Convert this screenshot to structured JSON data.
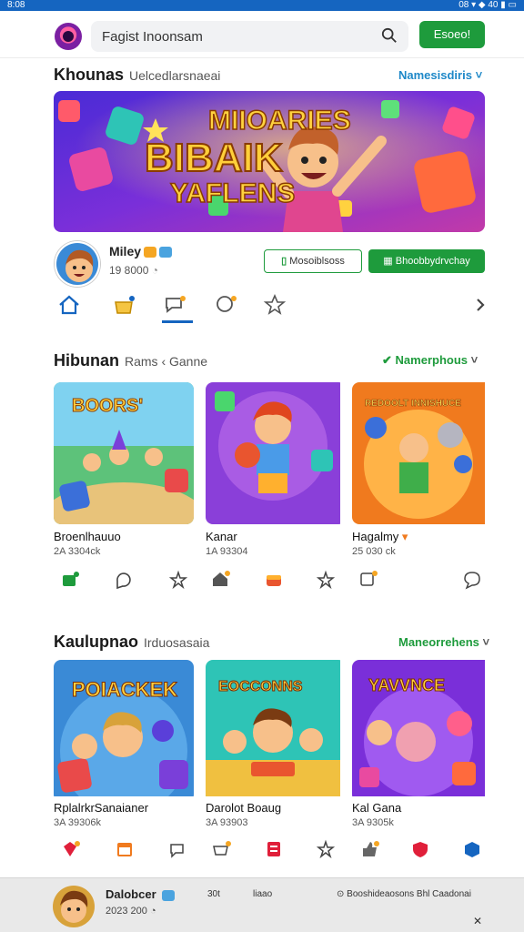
{
  "status": {
    "left": "8:08",
    "right": "08 ▾ ◆ 40 ▮ ▭"
  },
  "search": {
    "text": "Fagist Inoonsam"
  },
  "topbar": {
    "button_label": "Esoeo!"
  },
  "featured": {
    "title": "Khounas",
    "subtitle": "Uelcedlarsnaeai",
    "link": "Namesisdiris",
    "banner_line1": "MIIOARIES",
    "banner_line2": "BIBAIK",
    "banner_line3": "YAFLENS"
  },
  "profile": {
    "name": "Miley",
    "sub": "19 8000",
    "btn_outline": "Mosoiblsoss",
    "btn_fill": "Bhoobbydrvchay"
  },
  "section2": {
    "title": "Hibunan",
    "subtitle": "Rams ‹ Ganne",
    "link": "Namerphous",
    "cards": [
      {
        "title": "Broenlhauuo",
        "sub": "2A 3304ck",
        "art": "BOORS'"
      },
      {
        "title": "Kanar",
        "sub": "1A 93304",
        "art": ""
      },
      {
        "title": "Hagalmy",
        "sub": "25 030 ck",
        "art": "REDOOLT INNISHUCE"
      }
    ]
  },
  "section3": {
    "title": "Kaulupnao",
    "subtitle": "Irduosasaia",
    "link": "Maneorrehens",
    "cards": [
      {
        "title": "RplalrkrSanaianer",
        "sub": "3A 39306k",
        "art": "POIACKEK"
      },
      {
        "title": "Darolot Boaug",
        "sub": "3A 93903",
        "art": "EOCCONNS"
      },
      {
        "title": "Kal Gana",
        "sub": "3A 9305k",
        "art": "YAVVNCE"
      }
    ]
  },
  "bottom": {
    "name": "Dalobcer",
    "sub": "2023 200",
    "a1": "30t",
    "a2": "liaao",
    "a3": "Booshideaosons Bhl Caadonai"
  },
  "colors": {
    "accent": "#1565c0",
    "green": "#1e9b3c"
  }
}
